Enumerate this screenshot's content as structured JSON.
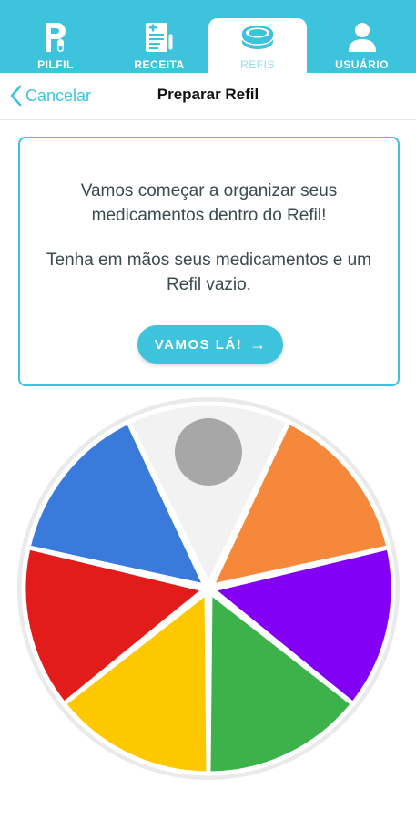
{
  "tabs": [
    {
      "label": "PILFIL",
      "icon": "pilfil-logo-icon",
      "active": false
    },
    {
      "label": "RECEITA",
      "icon": "prescription-icon",
      "active": false
    },
    {
      "label": "REFIS",
      "icon": "pill-case-icon",
      "active": true
    },
    {
      "label": "USUÁRIO",
      "icon": "user-icon",
      "active": false
    }
  ],
  "nav": {
    "back_label": "Cancelar",
    "title": "Preparar Refil"
  },
  "card": {
    "message1": "Vamos começar a organizar seus medicamentos dentro do Refil!",
    "message2": "Tenha em mãos seus medicamentos e um Refil vazio.",
    "cta_label": "VAMOS LÁ!"
  },
  "refil": {
    "compartments": [
      {
        "name": "start",
        "color": "#f2f2f2"
      },
      {
        "name": "orange",
        "color": "#f5883a"
      },
      {
        "name": "purple",
        "color": "#8400f5"
      },
      {
        "name": "green",
        "color": "#3db24b"
      },
      {
        "name": "yellow",
        "color": "#fdc800"
      },
      {
        "name": "red",
        "color": "#e21b1b"
      },
      {
        "name": "blue",
        "color": "#3a7adb"
      }
    ],
    "indicator_color": "#a7a7a7",
    "rim_color": "#eaeaea"
  },
  "colors": {
    "accent": "#3ec3dc"
  }
}
